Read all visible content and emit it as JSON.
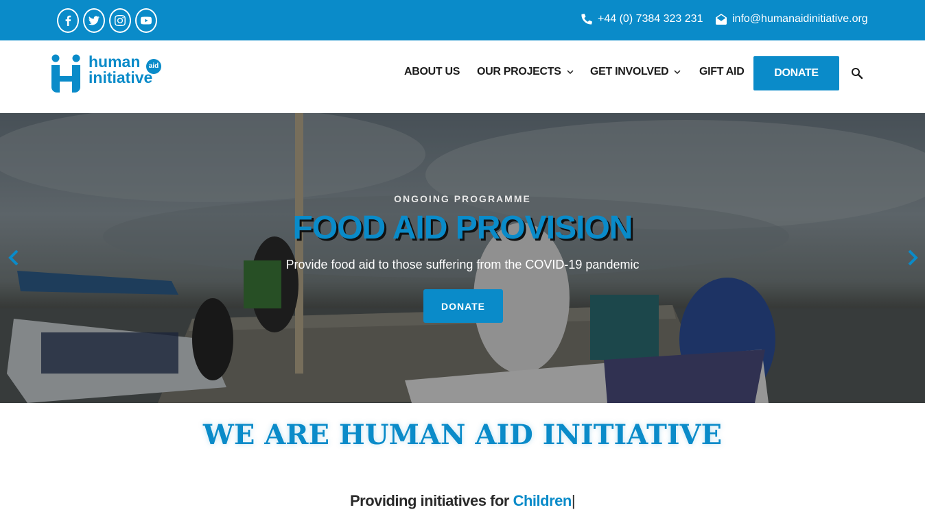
{
  "topbar": {
    "socials": [
      {
        "icon": "facebook-icon"
      },
      {
        "icon": "twitter-icon"
      },
      {
        "icon": "instagram-icon"
      },
      {
        "icon": "youtube-icon"
      }
    ],
    "phone": "+44 (0) 7384 323 231",
    "email": "info@humanaidinitiative.org"
  },
  "logo": {
    "line1": "human",
    "line2": "initiative",
    "badge": "aid"
  },
  "nav": {
    "items": [
      {
        "label": "ABOUT US",
        "dropdown": false
      },
      {
        "label": "OUR PROJECTS",
        "dropdown": true
      },
      {
        "label": "GET INVOLVED",
        "dropdown": true
      },
      {
        "label": "GIFT AID",
        "dropdown": false
      }
    ],
    "donate_label": "DONATE"
  },
  "hero": {
    "eyebrow": "ONGOING PROGRAMME",
    "title": "FOOD AID PROVISION",
    "subtitle": "Provide food aid to those suffering from the COVID-19 pandemic",
    "button": "DONATE"
  },
  "intro": {
    "title": "WE ARE HUMAN AID INITIATIVE",
    "typed_prefix": "Providing initiatives for",
    "typed_word": "Children",
    "cursor": "|"
  },
  "colors": {
    "brand": "#0a8bc9",
    "topbar": "#0a8bc9"
  }
}
